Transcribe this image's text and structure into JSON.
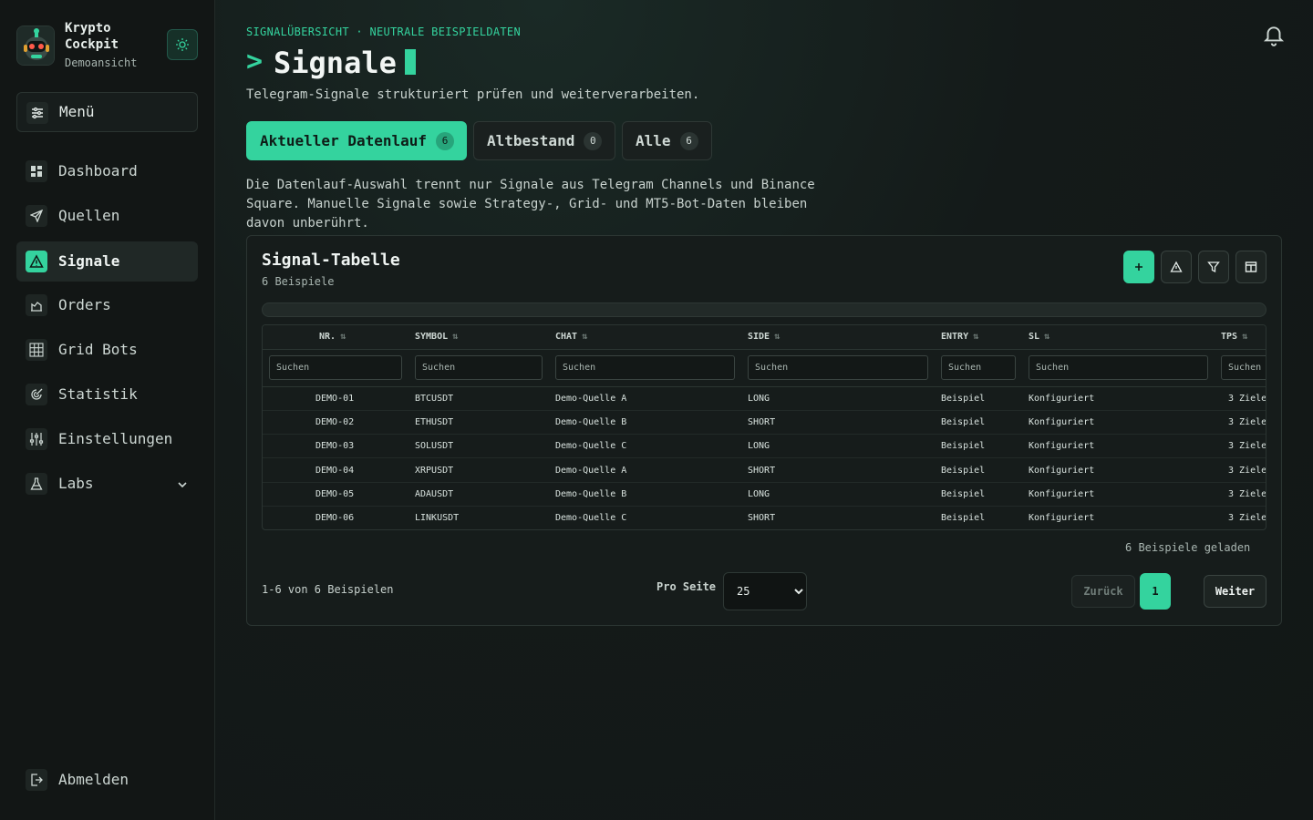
{
  "brand": {
    "title": "Krypto Cockpit",
    "subtitle": "Demoansicht"
  },
  "sidebar": {
    "menu_label": "Menü",
    "items": [
      {
        "label": "Dashboard",
        "icon": "dashboard-icon"
      },
      {
        "label": "Quellen",
        "icon": "send-icon"
      },
      {
        "label": "Signale",
        "icon": "warning-icon",
        "active": true
      },
      {
        "label": "Orders",
        "icon": "orders-icon"
      },
      {
        "label": "Grid Bots",
        "icon": "grid-icon"
      },
      {
        "label": "Statistik",
        "icon": "stats-icon"
      },
      {
        "label": "Einstellungen",
        "icon": "sliders-icon"
      },
      {
        "label": "Labs",
        "icon": "flask-icon",
        "expandable": true
      }
    ],
    "logout_label": "Abmelden"
  },
  "header": {
    "eyebrow": "SIGNALÜBERSICHT · NEUTRALE BEISPIELDATEN",
    "prompt": ">",
    "title": "Signale",
    "subtitle": "Telegram-Signale strukturiert prüfen und weiterverarbeiten."
  },
  "tabs": [
    {
      "label": "Aktueller Datenlauf",
      "count": "6",
      "active": true
    },
    {
      "label": "Altbestand",
      "count": "0"
    },
    {
      "label": "Alle",
      "count": "6"
    }
  ],
  "info_text": "Die Datenlauf-Auswahl trennt nur Signale aus Telegram Channels und Binance Square. Manuelle Signale sowie Strategy-, Grid- und MT5-Bot-Daten bleiben davon unberührt.",
  "card": {
    "title": "Signal-Tabelle",
    "subtitle": "6 Beispiele",
    "columns": [
      "NR.",
      "SYMBOL",
      "CHAT",
      "SIDE",
      "ENTRY",
      "SL",
      "TPS"
    ],
    "filter_placeholder": "Suchen",
    "rows": [
      [
        "DEMO-01",
        "BTCUSDT",
        "Demo-Quelle A",
        "LONG",
        "Beispiel",
        "Konfiguriert",
        "3 Ziele"
      ],
      [
        "DEMO-02",
        "ETHUSDT",
        "Demo-Quelle B",
        "SHORT",
        "Beispiel",
        "Konfiguriert",
        "3 Ziele"
      ],
      [
        "DEMO-03",
        "SOLUSDT",
        "Demo-Quelle C",
        "LONG",
        "Beispiel",
        "Konfiguriert",
        "3 Ziele"
      ],
      [
        "DEMO-04",
        "XRPUSDT",
        "Demo-Quelle A",
        "SHORT",
        "Beispiel",
        "Konfiguriert",
        "3 Ziele"
      ],
      [
        "DEMO-05",
        "ADAUSDT",
        "Demo-Quelle B",
        "LONG",
        "Beispiel",
        "Konfiguriert",
        "3 Ziele"
      ],
      [
        "DEMO-06",
        "LINKUSDT",
        "Demo-Quelle C",
        "SHORT",
        "Beispiel",
        "Konfiguriert",
        "3 Ziele"
      ]
    ],
    "loaded_text": "6 Beispiele geladen",
    "range_text": "1-6 von 6 Beispielen",
    "per_page_label": "Pro Seite",
    "per_page_value": "25",
    "prev_label": "Zurück",
    "current_page": "1",
    "next_label": "Weiter"
  },
  "colors": {
    "accent": "#34d39e",
    "background": "#121817",
    "surface": "#161c1b"
  }
}
